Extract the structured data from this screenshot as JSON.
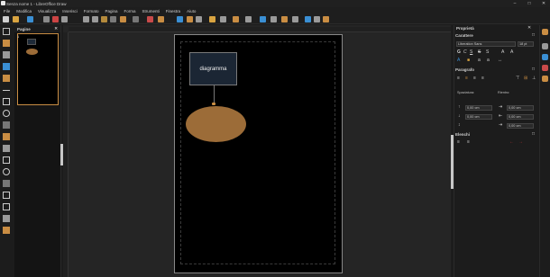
{
  "window": {
    "title": "Senza nome 1 - LibreOffice Draw"
  },
  "menu": [
    "File",
    "Modifica",
    "Visualizza",
    "Inserisci",
    "Formato",
    "Pagina",
    "Forma",
    "Strumenti",
    "Finestra",
    "Aiuto"
  ],
  "pages_panel": {
    "title": "Pagine",
    "page_number": "1"
  },
  "canvas": {
    "rect_text": "diagramma"
  },
  "sidebar": {
    "title": "Proprietà",
    "character_title": "Carattere",
    "font_name": "Liberation Sans",
    "font_size": "18 pt",
    "paragraph_title": "Paragrafo",
    "spacing_label": "Spaziatura:",
    "indent_label": "Rientro:",
    "spacing_values": [
      "0,00 cm",
      "0,00 cm",
      "0,00 cm"
    ],
    "indent_values": [
      "0,00 cm",
      "0,00 cm",
      "0,00 cm"
    ],
    "lists_title": "Elenchi"
  },
  "colors": {
    "accent": "#c98d43",
    "ellipse": "#9c6c38",
    "rect": "#1b2634"
  }
}
